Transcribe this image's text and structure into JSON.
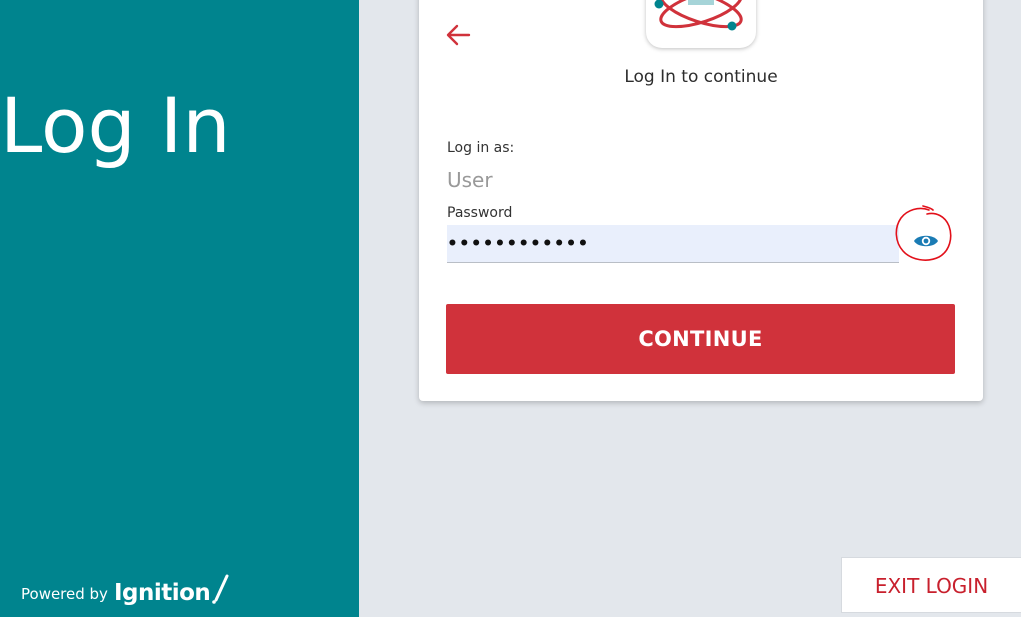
{
  "left_panel": {
    "title": "Log In",
    "powered_by": "Powered by",
    "brand": "Ignition"
  },
  "card": {
    "subtitle": "Log In to continue",
    "login_as_label": "Log in as:",
    "login_as_value": "User",
    "password_label": "Password",
    "password_value": "••••••••••••",
    "continue_label": "CONTINUE"
  },
  "footer": {
    "exit_label": "EXIT LOGIN"
  },
  "icons": {
    "back": "arrow-left-icon",
    "show_password": "eye-icon",
    "app_logo": "atom-logo-icon"
  },
  "colors": {
    "teal": "#00848e",
    "accent_red": "#d0323b",
    "eye_blue": "#1a7bb4",
    "background": "#e3e7ec"
  }
}
